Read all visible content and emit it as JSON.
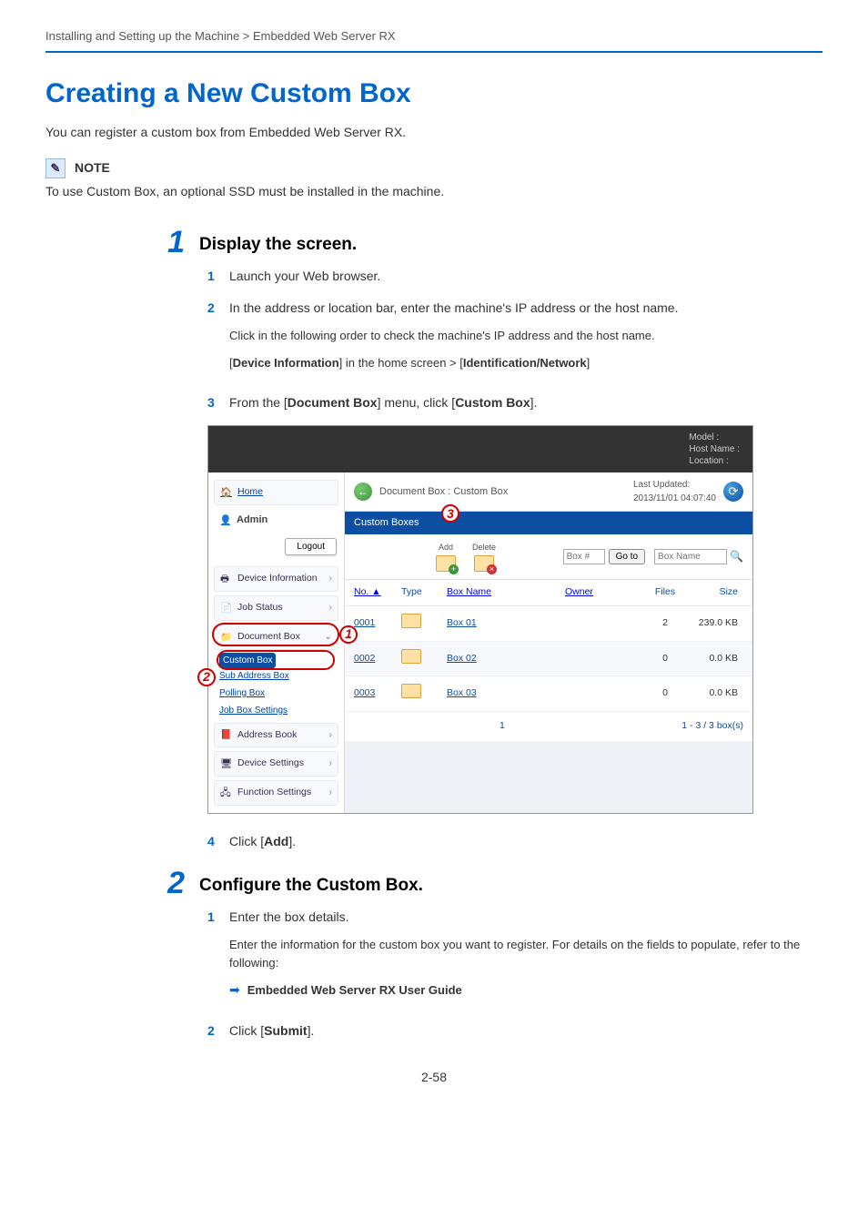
{
  "breadcrumb": "Installing and Setting up the Machine > Embedded Web Server RX",
  "title": "Creating a New Custom Box",
  "intro": "You can register a custom box from Embedded Web Server RX.",
  "note": {
    "label": "NOTE",
    "text": "To use Custom Box, an optional SSD must be installed in the machine."
  },
  "step1": {
    "num": "1",
    "title": "Display the screen.",
    "subs": {
      "s1": {
        "n": "1",
        "t": "Launch your Web browser."
      },
      "s2": {
        "n": "2",
        "t1": "In the address or location bar, enter the machine's IP address or the host name.",
        "t2": "Click in the following order to check the machine's IP address and the host name.",
        "t3a": "[",
        "t3b": "Device Information",
        "t3c": "] in the home screen > [",
        "t3d": "Identification/Network",
        "t3e": "]"
      },
      "s3": {
        "n": "3",
        "ta": "From the [",
        "tb": "Document Box",
        "tc": "] menu, click [",
        "td": "Custom Box",
        "te": "]."
      },
      "s4": {
        "n": "4",
        "ta": "Click [",
        "tb": "Add",
        "tc": "]."
      }
    }
  },
  "step2": {
    "num": "2",
    "title": "Configure the Custom Box.",
    "subs": {
      "s1": {
        "n": "1",
        "t1": "Enter the box details.",
        "t2": "Enter the information for the custom box you want to register. For details on the fields to populate, refer to the following:",
        "ref": "Embedded Web Server RX User Guide"
      },
      "s2": {
        "n": "2",
        "ta": "Click [",
        "tb": "Submit",
        "tc": "]."
      }
    }
  },
  "shot": {
    "top": {
      "model": "Model :",
      "host": "Host Name :",
      "loc": "Location :"
    },
    "bc": "Document Box : Custom Box",
    "upd_label": "Last Updated:",
    "upd_value": "2013/11/01 04:07:40",
    "nav": {
      "home": "Home",
      "admin": "Admin",
      "logout": "Logout",
      "devinfo": "Device Information",
      "jobstatus": "Job Status",
      "docbox": "Document Box",
      "custom": "Custom Box",
      "subaddr": "Sub Address Box",
      "polling": "Polling Box",
      "jobbox": "Job Box Settings",
      "addr": "Address Book",
      "devset": "Device Settings",
      "funcset": "Function Settings"
    },
    "tab": "Custom Boxes",
    "toolbar": {
      "add": "Add",
      "delete": "Delete",
      "boxnum_ph": "Box #",
      "goto": "Go to",
      "boxname_ph": "Box Name"
    },
    "cols": {
      "no": "No. ▲",
      "type": "Type",
      "name": "Box Name",
      "owner": "Owner",
      "files": "Files",
      "size": "Size"
    },
    "rows": [
      {
        "no": "0001",
        "name": "Box 01",
        "owner": "",
        "files": "2",
        "size": "239.0 KB"
      },
      {
        "no": "0002",
        "name": "Box 02",
        "owner": "",
        "files": "0",
        "size": "0.0 KB"
      },
      {
        "no": "0003",
        "name": "Box 03",
        "owner": "",
        "files": "0",
        "size": "0.0 KB"
      }
    ],
    "pager_left": "1",
    "pager_right": "1 - 3 / 3 box(s)",
    "callouts": {
      "c1": "1",
      "c2": "2",
      "c3": "3"
    }
  },
  "page_no": "2-58"
}
